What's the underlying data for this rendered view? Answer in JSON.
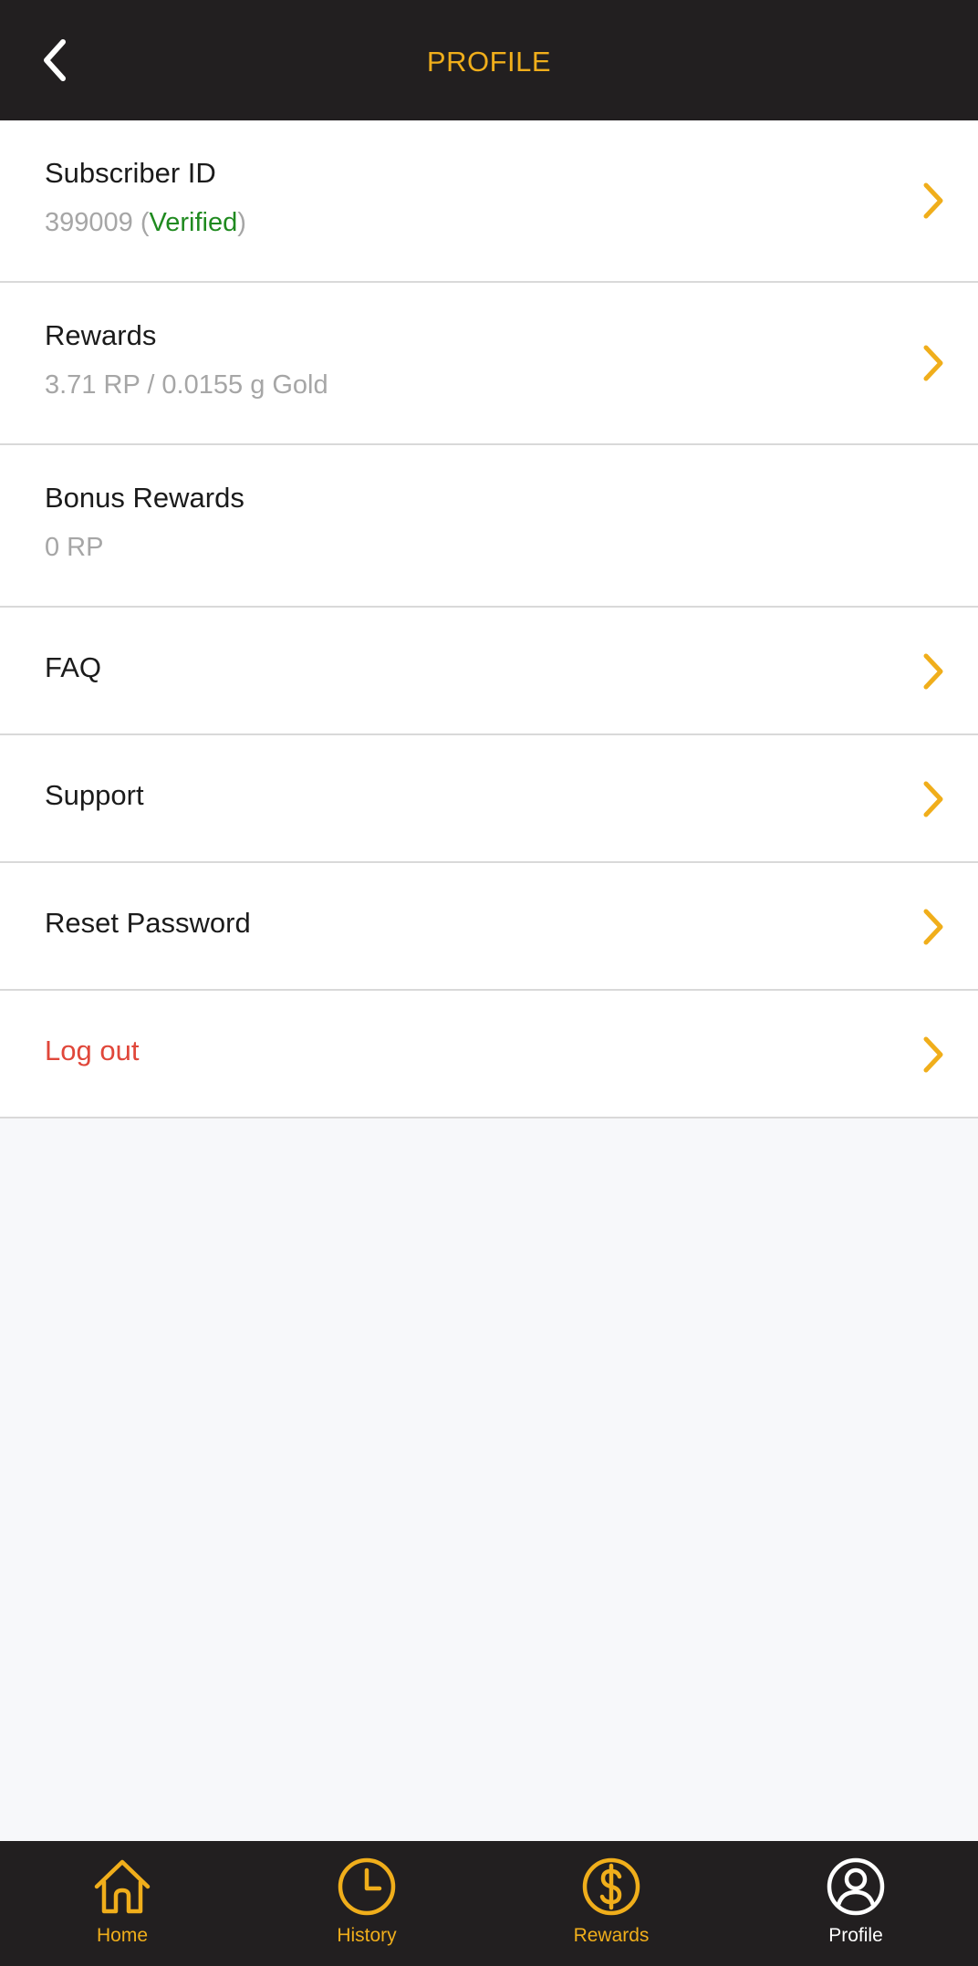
{
  "header": {
    "title": "PROFILE",
    "back_icon": "chevron-left-icon"
  },
  "rows": [
    {
      "label": "Subscriber ID",
      "sub_value": "399009",
      "sub_open": " (",
      "sub_status": "Verified",
      "sub_close": ")"
    },
    {
      "label": "Rewards",
      "sub": "3.71 RP / 0.0155 g Gold"
    },
    {
      "label": "Bonus Rewards",
      "sub": "0 RP"
    },
    {
      "label": "FAQ"
    },
    {
      "label": "Support"
    },
    {
      "label": "Reset Password"
    },
    {
      "label": "Log out"
    }
  ],
  "nav": [
    {
      "label": "Home",
      "icon": "home-icon"
    },
    {
      "label": "History",
      "icon": "clock-icon"
    },
    {
      "label": "Rewards",
      "icon": "dollar-icon"
    },
    {
      "label": "Profile",
      "icon": "user-icon"
    }
  ],
  "colors": {
    "accent": "#f0ae1b",
    "header_bg": "#221f20",
    "verified": "#1f8a1f",
    "danger": "#e0473a"
  }
}
